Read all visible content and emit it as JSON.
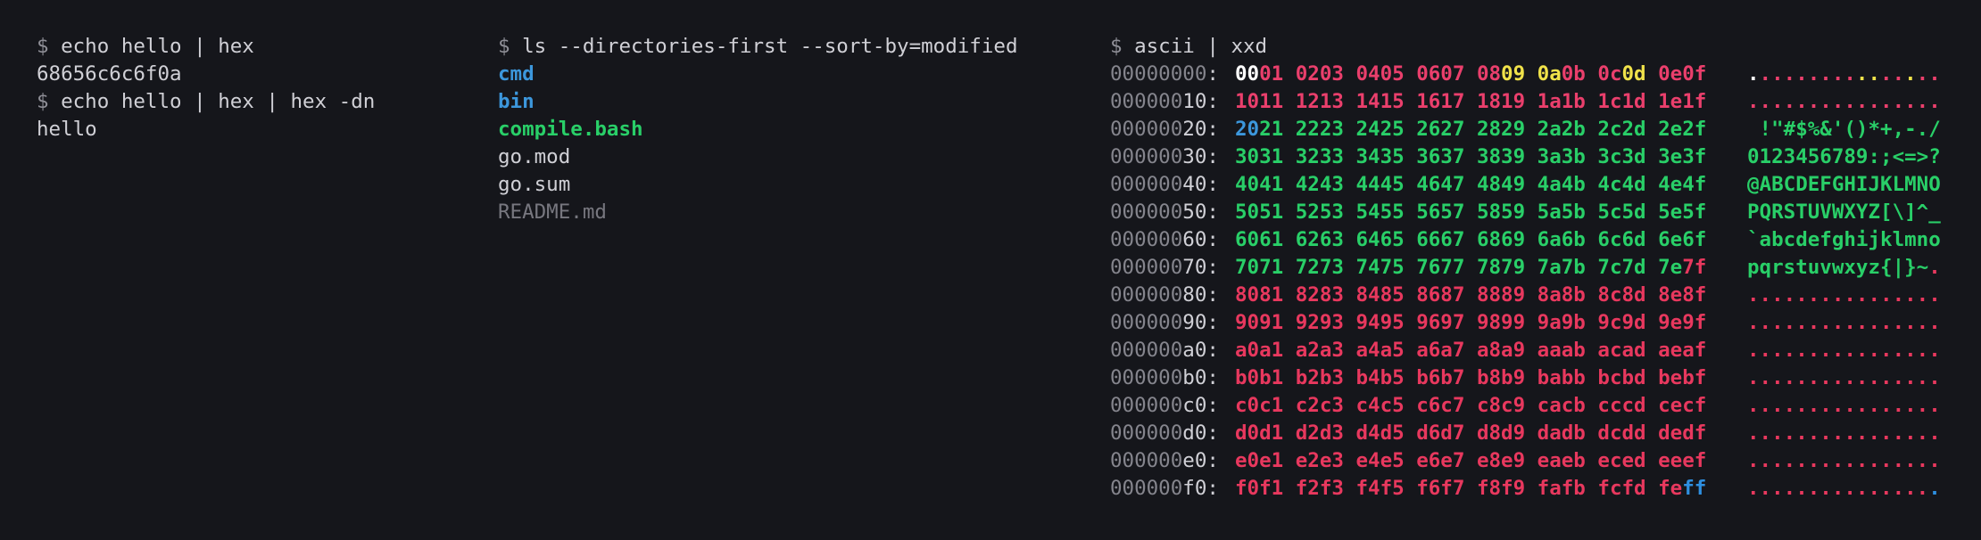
{
  "panel1": {
    "lines": [
      {
        "type": "cmd",
        "prompt": "$",
        "text": "echo hello | hex"
      },
      {
        "type": "out",
        "text": "68656c6c6f0a"
      },
      {
        "type": "cmd",
        "prompt": "$",
        "text": "echo hello | hex | hex -dn"
      },
      {
        "type": "out",
        "text": "hello"
      }
    ]
  },
  "panel2": {
    "prompt": "$",
    "command": "ls --directories-first --sort-by=modified",
    "entries": [
      {
        "name": "cmd",
        "kind": "dir"
      },
      {
        "name": "bin",
        "kind": "dir"
      },
      {
        "name": "compile.bash",
        "kind": "exe"
      },
      {
        "name": "go.mod",
        "kind": "file"
      },
      {
        "name": "go.sum",
        "kind": "file"
      },
      {
        "name": "README.md",
        "kind": "dim"
      }
    ]
  },
  "panel3": {
    "prompt": "$",
    "command": "ascii | xxd",
    "rows": [
      {
        "offset": "00000000:",
        "ascii": "................"
      },
      {
        "offset": "00000010:",
        "ascii": "................"
      },
      {
        "offset": "00000020:",
        "ascii": " !\"#$%&'()*+,-./"
      },
      {
        "offset": "00000030:",
        "ascii": "0123456789:;<=>?"
      },
      {
        "offset": "00000040:",
        "ascii": "@ABCDEFGHIJKLMNO"
      },
      {
        "offset": "00000050:",
        "ascii": "PQRSTUVWXYZ[\\]^_"
      },
      {
        "offset": "00000060:",
        "ascii": "`abcdefghijklmno"
      },
      {
        "offset": "00000070:",
        "ascii": "pqrstuvwxyz{|}~."
      },
      {
        "offset": "00000080:",
        "ascii": "................"
      },
      {
        "offset": "00000090:",
        "ascii": "................"
      },
      {
        "offset": "000000a0:",
        "ascii": "................"
      },
      {
        "offset": "000000b0:",
        "ascii": "................"
      },
      {
        "offset": "000000c0:",
        "ascii": "................"
      },
      {
        "offset": "000000d0:",
        "ascii": "................"
      },
      {
        "offset": "000000e0:",
        "ascii": "................"
      },
      {
        "offset": "000000f0:",
        "ascii": "................"
      }
    ]
  },
  "colors": {
    "background": "#15161b",
    "prompt": "#8e8e96",
    "directory": "#3c97dc",
    "executable": "#29cf68",
    "null_byte": "#ffffff",
    "control_byte": "#f0c43c",
    "printable_byte": "#29cf68",
    "high_byte": "#e8385e",
    "ff_byte": "#2e8fe0"
  }
}
